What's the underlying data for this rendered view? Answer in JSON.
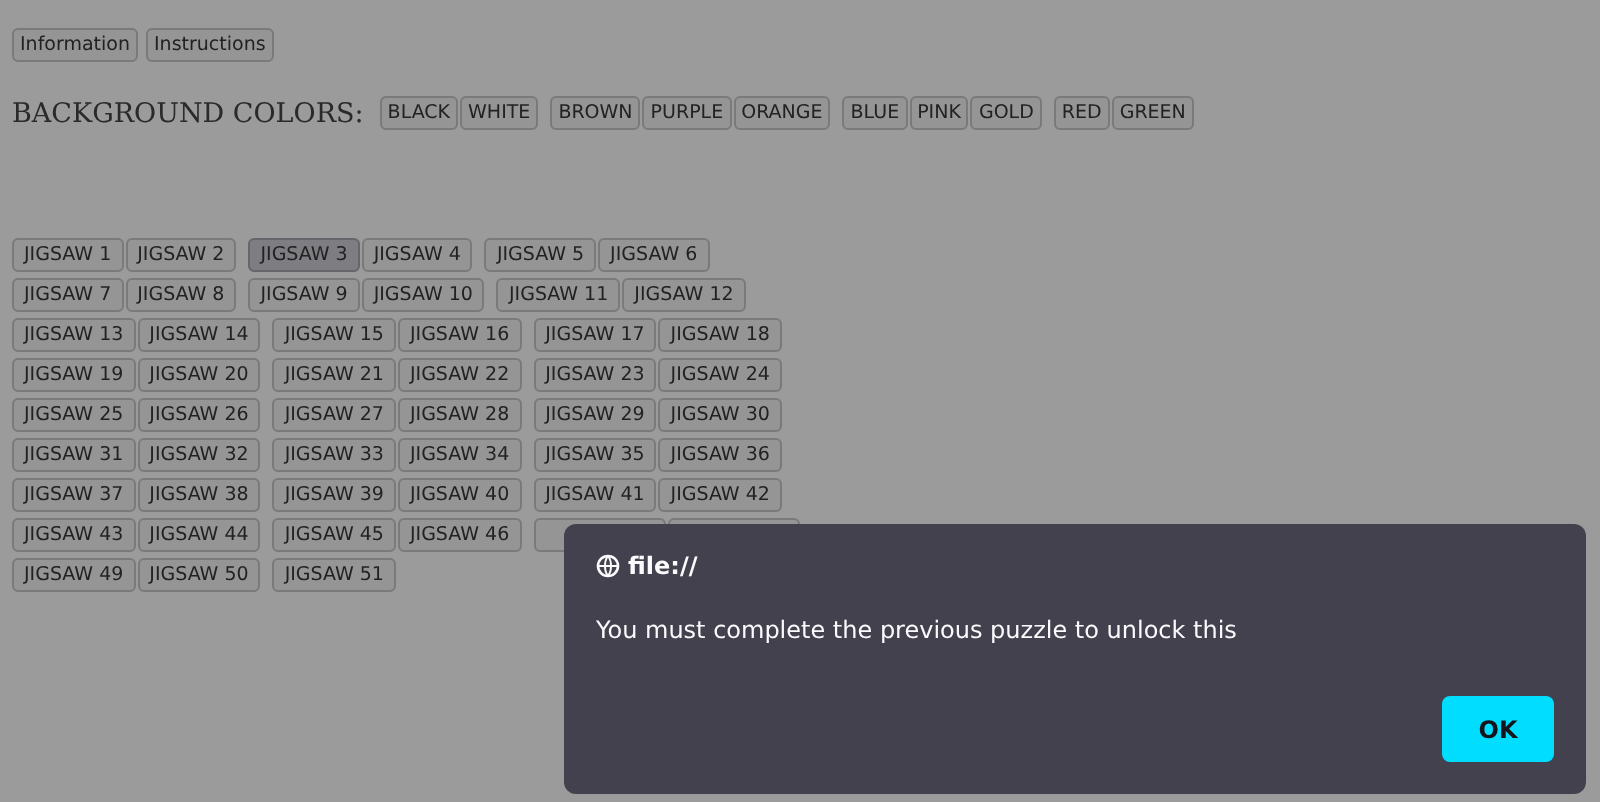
{
  "top_buttons": [
    "Information",
    "Instructions"
  ],
  "background_colors": {
    "label": "BACKGROUND COLORS:",
    "groups": [
      [
        "BLACK",
        "WHITE"
      ],
      [
        "BROWN",
        "PURPLE",
        "ORANGE"
      ],
      [
        "BLUE",
        "PINK",
        "GOLD"
      ],
      [
        "RED",
        "GREEN"
      ]
    ]
  },
  "jigsaws": [
    {
      "label": "JIGSAW 1",
      "selected": false
    },
    {
      "label": "JIGSAW 2",
      "selected": false
    },
    {
      "label": "JIGSAW 3",
      "selected": true
    },
    {
      "label": "JIGSAW 4",
      "selected": false
    },
    {
      "label": "JIGSAW 5",
      "selected": false
    },
    {
      "label": "JIGSAW 6",
      "selected": false
    },
    {
      "label": "JIGSAW 7",
      "selected": false
    },
    {
      "label": "JIGSAW 8",
      "selected": false
    },
    {
      "label": "JIGSAW 9",
      "selected": false
    },
    {
      "label": "JIGSAW 10",
      "selected": false
    },
    {
      "label": "JIGSAW 11",
      "selected": false
    },
    {
      "label": "JIGSAW 12",
      "selected": false
    },
    {
      "label": "JIGSAW 13",
      "selected": false
    },
    {
      "label": "JIGSAW 14",
      "selected": false
    },
    {
      "label": "JIGSAW 15",
      "selected": false
    },
    {
      "label": "JIGSAW 16",
      "selected": false
    },
    {
      "label": "JIGSAW 17",
      "selected": false
    },
    {
      "label": "JIGSAW 18",
      "selected": false
    },
    {
      "label": "JIGSAW 19",
      "selected": false
    },
    {
      "label": "JIGSAW 20",
      "selected": false
    },
    {
      "label": "JIGSAW 21",
      "selected": false
    },
    {
      "label": "JIGSAW 22",
      "selected": false
    },
    {
      "label": "JIGSAW 23",
      "selected": false
    },
    {
      "label": "JIGSAW 24",
      "selected": false
    },
    {
      "label": "JIGSAW 25",
      "selected": false
    },
    {
      "label": "JIGSAW 26",
      "selected": false
    },
    {
      "label": "JIGSAW 27",
      "selected": false
    },
    {
      "label": "JIGSAW 28",
      "selected": false
    },
    {
      "label": "JIGSAW 29",
      "selected": false
    },
    {
      "label": "JIGSAW 30",
      "selected": false
    },
    {
      "label": "JIGSAW 31",
      "selected": false
    },
    {
      "label": "JIGSAW 32",
      "selected": false
    },
    {
      "label": "JIGSAW 33",
      "selected": false
    },
    {
      "label": "JIGSAW 34",
      "selected": false
    },
    {
      "label": "JIGSAW 35",
      "selected": false
    },
    {
      "label": "JIGSAW 36",
      "selected": false
    },
    {
      "label": "JIGSAW 37",
      "selected": false
    },
    {
      "label": "JIGSAW 38",
      "selected": false
    },
    {
      "label": "JIGSAW 39",
      "selected": false
    },
    {
      "label": "JIGSAW 40",
      "selected": false
    },
    {
      "label": "JIGSAW 41",
      "selected": false
    },
    {
      "label": "JIGSAW 42",
      "selected": false
    },
    {
      "label": "JIGSAW 43",
      "selected": false
    },
    {
      "label": "JIGSAW 44",
      "selected": false
    },
    {
      "label": "JIGSAW 45",
      "selected": false
    },
    {
      "label": "JIGSAW 46",
      "selected": false
    },
    {
      "kind": "covered",
      "selected": false
    },
    {
      "kind": "covered",
      "selected": false
    },
    {
      "label": "JIGSAW 49",
      "selected": false
    },
    {
      "label": "JIGSAW 50",
      "selected": false
    },
    {
      "label": "JIGSAW 51",
      "selected": false
    }
  ],
  "dialog": {
    "origin": "file://",
    "message": "You must complete the previous puzzle to unlock this",
    "button": "OK"
  }
}
